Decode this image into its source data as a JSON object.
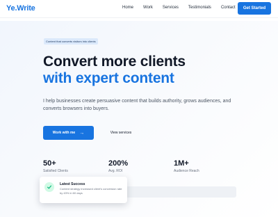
{
  "nav": {
    "logo": "Ye.Write",
    "links": [
      "Home",
      "Work",
      "Services",
      "Testimonials",
      "Contact"
    ],
    "cta": "Get Started"
  },
  "hero": {
    "badge": "Content that converts visitors into clients",
    "headline_line1": "Convert more clients",
    "headline_line2": "with expert content",
    "lead": "I help businesses create persuasive content that builds authority, grows audiences, and converts browsers into buyers.",
    "primary_button": "Work with me",
    "secondary_button": "View services"
  },
  "stats": [
    {
      "value": "50+",
      "label": "Satisfied Clients"
    },
    {
      "value": "200%",
      "label": "Avg. ROI"
    },
    {
      "value": "1M+",
      "label": "Audience Reach"
    }
  ],
  "toast": {
    "title": "Latest Success",
    "body": "Content strategy increased client's conversion rate by 43% in 60 days",
    "icon": "check-icon"
  },
  "colors": {
    "accent": "#1874e0",
    "success": "#10b981"
  }
}
